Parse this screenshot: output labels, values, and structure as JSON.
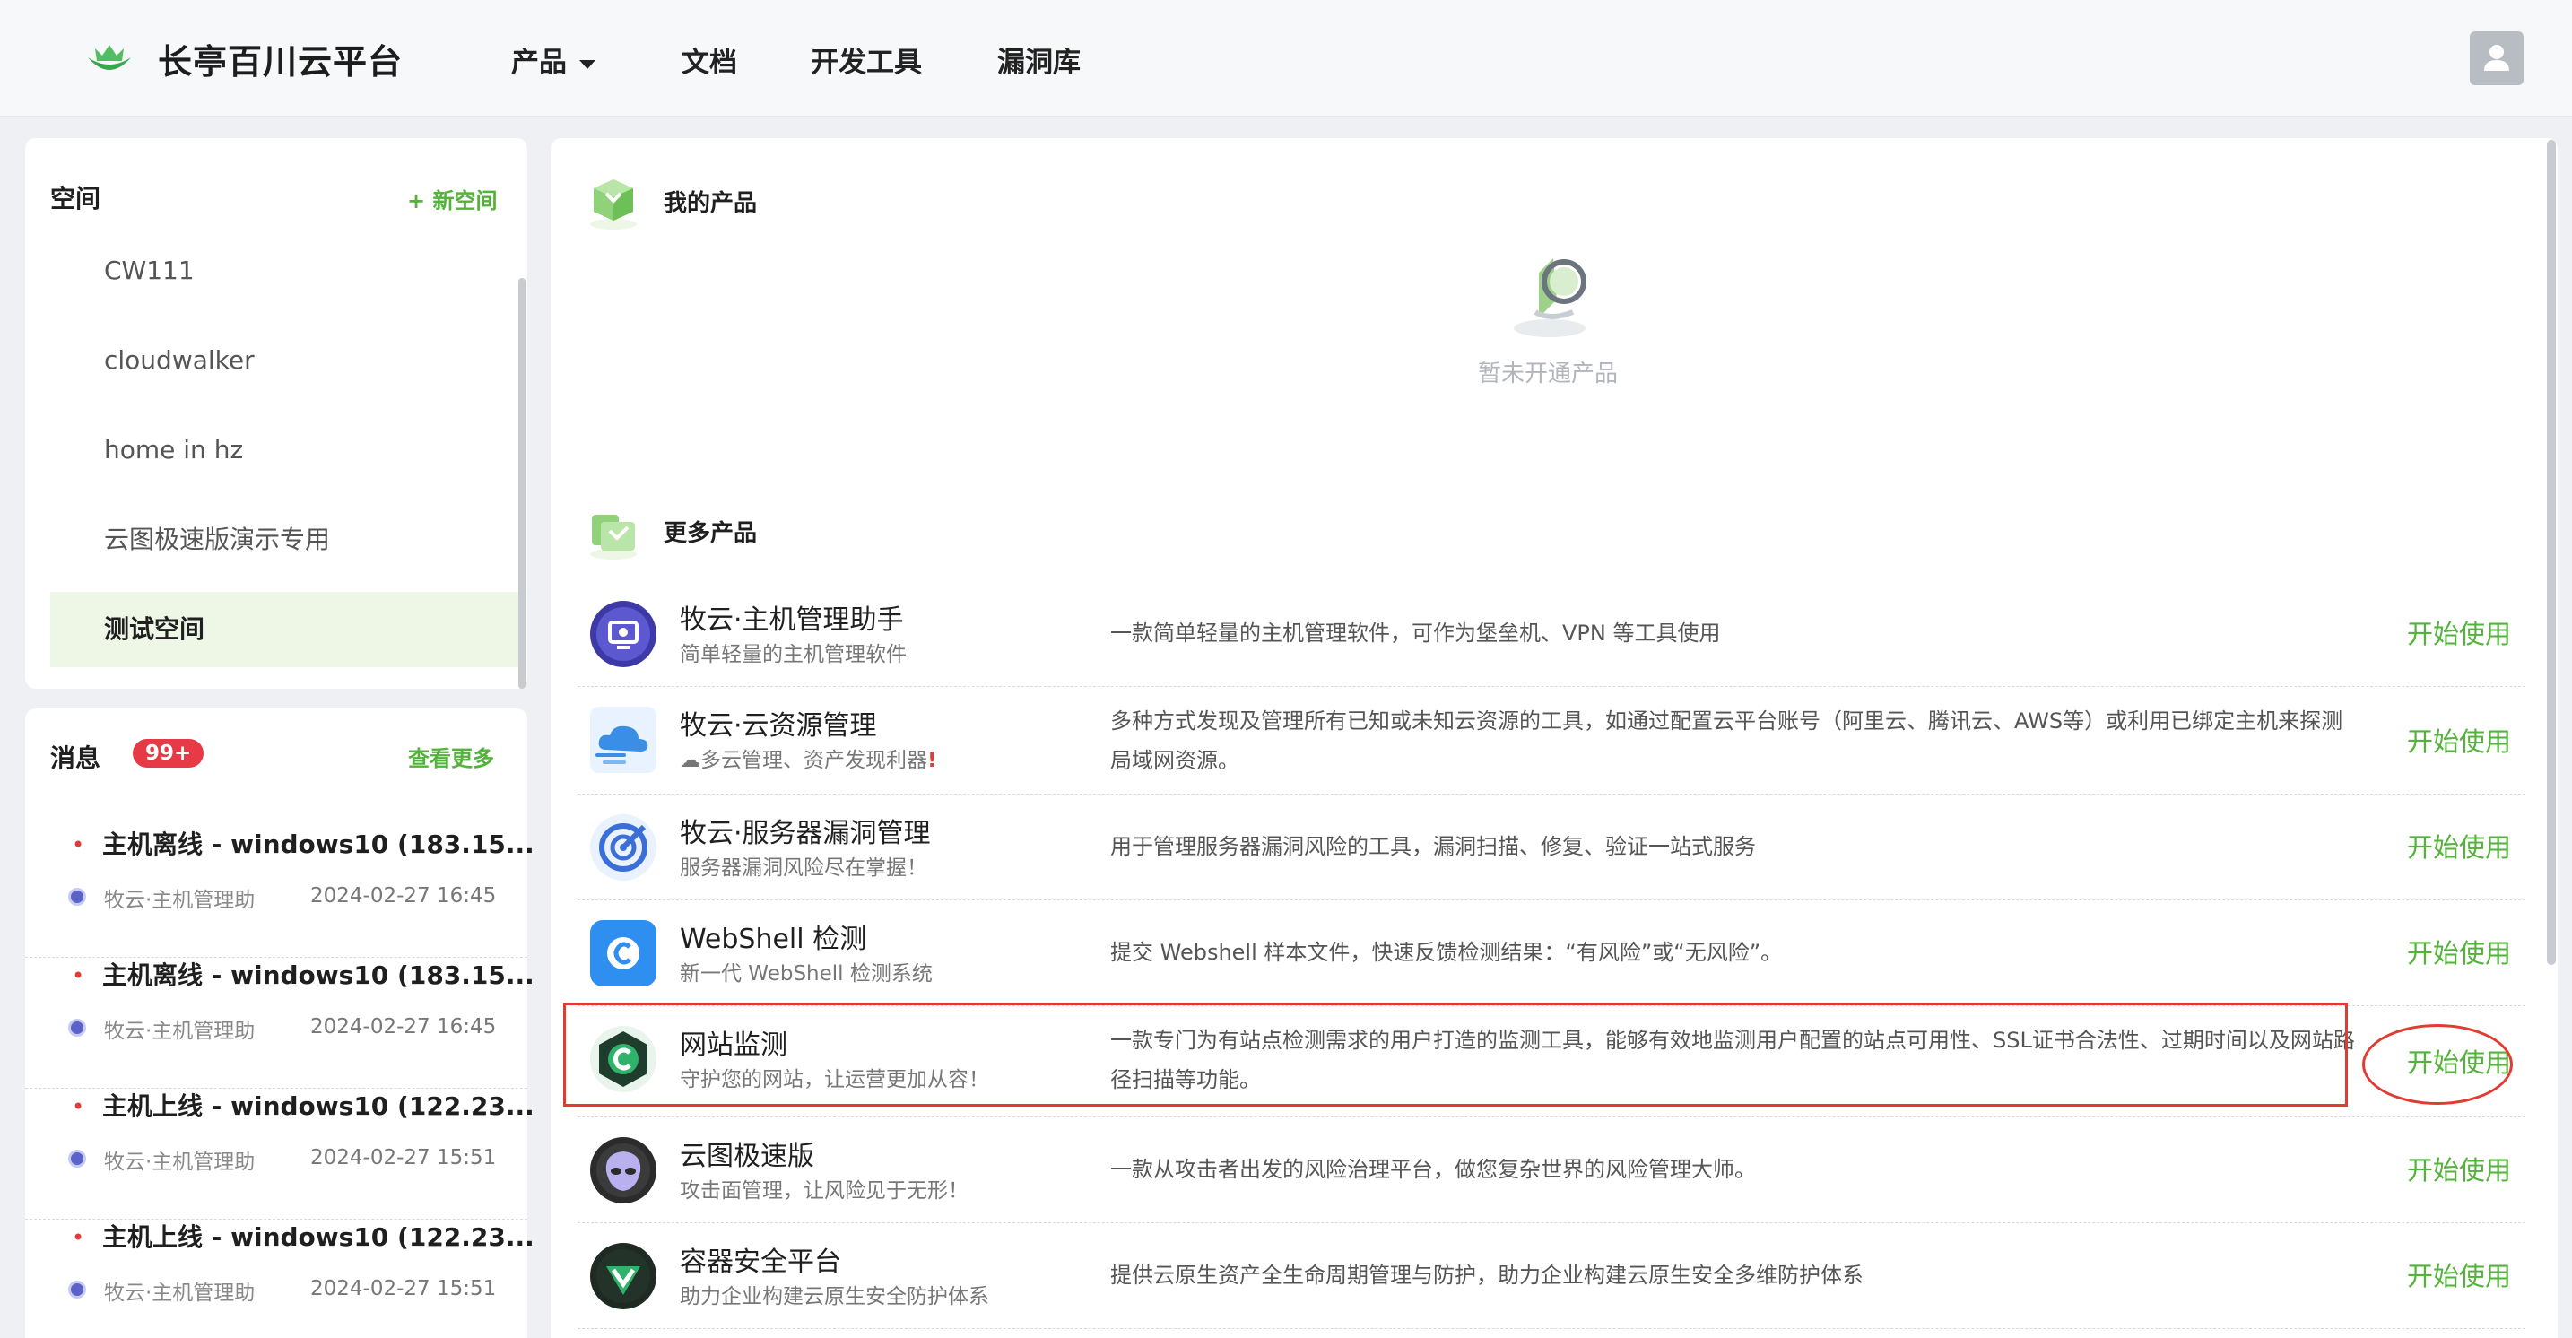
{
  "header": {
    "brand": "长亭百川云平台",
    "nav": [
      {
        "label": "产品",
        "has_dropdown": true
      },
      {
        "label": "文档"
      },
      {
        "label": "开发工具"
      },
      {
        "label": "漏洞库"
      }
    ],
    "avatar_icon": "user-icon"
  },
  "spaces": {
    "title": "空间",
    "new_label": "+ 新空间",
    "items": [
      "CW111",
      "cloudwalker",
      "home in hz",
      "云图极速版演示专用",
      "测试空间"
    ],
    "active_index": 4
  },
  "messages": {
    "title": "消息",
    "badge": "99+",
    "more_label": "查看更多",
    "items": [
      {
        "title": "主机离线 - windows10 (183.15...",
        "source": "牧云·主机管理助",
        "time": "2024-02-27 16:45"
      },
      {
        "title": "主机离线 - windows10 (183.15...",
        "source": "牧云·主机管理助",
        "time": "2024-02-27 16:45"
      },
      {
        "title": "主机上线 - windows10 (122.23...",
        "source": "牧云·主机管理助",
        "time": "2024-02-27 15:51"
      },
      {
        "title": "主机上线 - windows10 (122.23...",
        "source": "牧云·主机管理助",
        "time": "2024-02-27 15:51"
      }
    ]
  },
  "my_products": {
    "title": "我的产品",
    "empty_text": "暂未开通产品"
  },
  "more_products": {
    "title": "更多产品",
    "start_label": "开始使用",
    "items": [
      {
        "name": "牧云·主机管理助手",
        "subtitle": "简单轻量的主机管理软件",
        "desc": "一款简单轻量的主机管理软件，可作为堡垒机、VPN 等工具使用",
        "icon": "monitor-icon",
        "color": "#4b49b8"
      },
      {
        "name": "牧云·云资源管理",
        "subtitle": "☁多云管理、资产发现利器",
        "subtitle_warn": "!",
        "desc": "多种方式发现及管理所有已知或未知云资源的工具，如通过配置云平台账号（阿里云、腾讯云、AWS等）或利用已绑定主机来探测局域网资源。",
        "icon": "cloud-icon",
        "color": "#3a8ee6"
      },
      {
        "name": "牧云·服务器漏洞管理",
        "subtitle": "服务器漏洞风险尽在掌握！",
        "desc": "用于管理服务器漏洞风险的工具，漏洞扫描、修复、验证一站式服务",
        "icon": "target-icon",
        "color": "#3a6fd8"
      },
      {
        "name": "WebShell 检测",
        "subtitle": "新一代 WebShell 检测系统",
        "desc": "提交 Webshell 样本文件，快速反馈检测结果：“有风险”或“无风险”。",
        "icon": "webshell-icon",
        "color": "#2f8ff0"
      },
      {
        "name": "网站监测",
        "subtitle": "守护您的网站，让运营更加从容！",
        "desc": "一款专门为有站点检测需求的用户打造的监测工具，能够有效地监测用户配置的站点可用性、SSL证书合法性、过期时间以及网站路径扫描等功能。",
        "icon": "website-monitor-icon",
        "color": "#1f8a55"
      },
      {
        "name": "云图极速版",
        "subtitle": "攻击面管理，让风险见于无形！",
        "desc": "一款从攻击者出发的风险治理平台，做您复杂世界的风险管理大师。",
        "icon": "alien-icon",
        "color": "#3a3a3a"
      },
      {
        "name": "容器安全平台",
        "subtitle": "助力企业构建云原生安全防护体系",
        "desc": "提供云原生资产全生命周期管理与防护，助力企业构建云原生安全多维防护体系",
        "icon": "container-shield-icon",
        "color": "#1f7a44"
      }
    ]
  },
  "colors": {
    "accent_green": "#52b23a",
    "highlight_red": "#e13b32",
    "badge_red": "#e63b46"
  }
}
